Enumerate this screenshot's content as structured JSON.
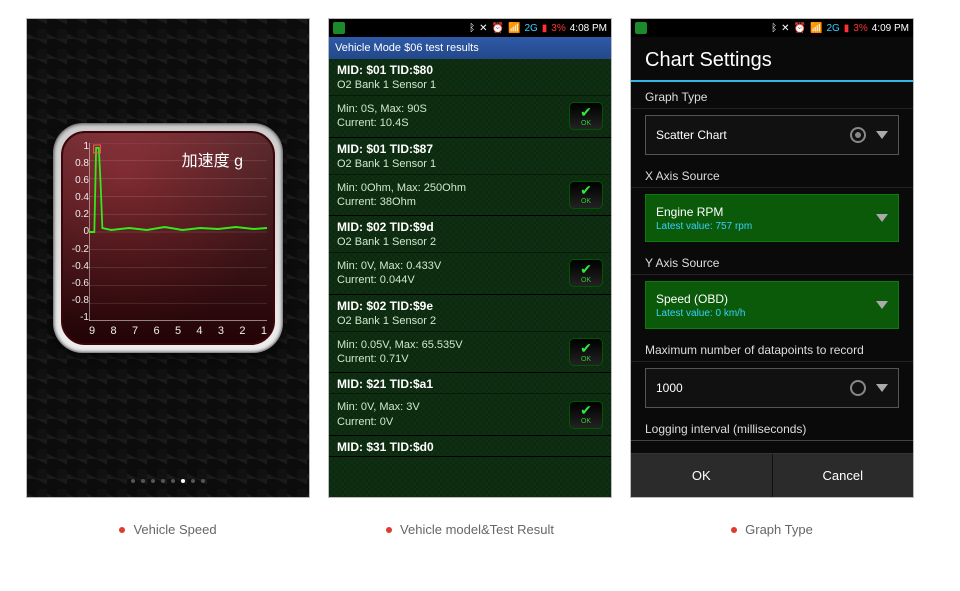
{
  "status": {
    "battery": "3%",
    "time1": "4:08 PM",
    "time2": "4:09 PM",
    "net": "2G"
  },
  "screen1": {
    "caption": "Vehicle Speed",
    "gauge_title": "加速度 g",
    "y_ticks": [
      "1",
      "0.8",
      "0.6",
      "0.4",
      "0.2",
      "0",
      "-0.2",
      "-0.4",
      "-0.6",
      "-0.8",
      "-1"
    ],
    "x_ticks": [
      "9",
      "8",
      "7",
      "6",
      "5",
      "4",
      "3",
      "2",
      "1"
    ],
    "page_dots_total": 8,
    "page_dot_active": 5
  },
  "chart_data": {
    "type": "line",
    "title": "加速度 g",
    "xlabel": "",
    "ylabel": "",
    "ylim": [
      -1,
      1
    ],
    "x": [
      9.0,
      8.8,
      8.7,
      8.6,
      8.55,
      8.5,
      8.0,
      7.5,
      7.0,
      6.5,
      6.0,
      5.5,
      5.0,
      4.5,
      4.0,
      3.5,
      3.0,
      2.5,
      2.0,
      1.5,
      1.0
    ],
    "values": [
      0.0,
      0.0,
      0.95,
      0.95,
      0.55,
      0.05,
      0.02,
      0.05,
      0.03,
      0.06,
      0.02,
      0.04,
      0.05,
      0.03,
      0.06,
      0.03,
      0.05,
      0.04,
      0.03,
      0.05,
      0.04
    ]
  },
  "screen2": {
    "caption": "Vehicle model&Test Result",
    "header": "Vehicle Mode $06 test results",
    "groups": [
      {
        "head": "MID: $01 TID:$80",
        "sub": "O2 Bank 1 Sensor 1",
        "line1": "Min: 0S, Max: 90S",
        "line2": "Current: 10.4S"
      },
      {
        "head": "MID: $01 TID:$87",
        "sub": "O2 Bank 1 Sensor 1",
        "line1": "Min: 0Ohm, Max: 250Ohm",
        "line2": "Current: 38Ohm"
      },
      {
        "head": "MID: $02 TID:$9d",
        "sub": "O2 Bank 1 Sensor 2",
        "line1": "Min: 0V, Max: 0.433V",
        "line2": "Current: 0.044V"
      },
      {
        "head": "MID: $02 TID:$9e",
        "sub": "O2 Bank 1 Sensor 2",
        "line1": "Min: 0.05V, Max: 65.535V",
        "line2": "Current: 0.71V"
      },
      {
        "head": "MID: $21 TID:$a1",
        "sub": "",
        "line1": "Min: 0V, Max: 3V",
        "line2": "Current: 0V"
      },
      {
        "head": "MID: $31 TID:$d0",
        "sub": "",
        "line1": "",
        "line2": ""
      }
    ]
  },
  "screen3": {
    "caption": "Graph Type",
    "title": "Chart Settings",
    "labels": {
      "graph_type": "Graph Type",
      "x_axis": "X Axis Source",
      "y_axis": "Y Axis Source",
      "max_points": "Maximum number of datapoints to record",
      "interval": "Logging interval (milliseconds)"
    },
    "graph_type_value": "Scatter Chart",
    "x_source": "Engine RPM",
    "x_latest": "Latest value: 757 rpm",
    "y_source": "Speed (OBD)",
    "y_latest": "Latest value: 0 km/h",
    "max_points_value": "1000",
    "ok": "OK",
    "cancel": "Cancel"
  }
}
